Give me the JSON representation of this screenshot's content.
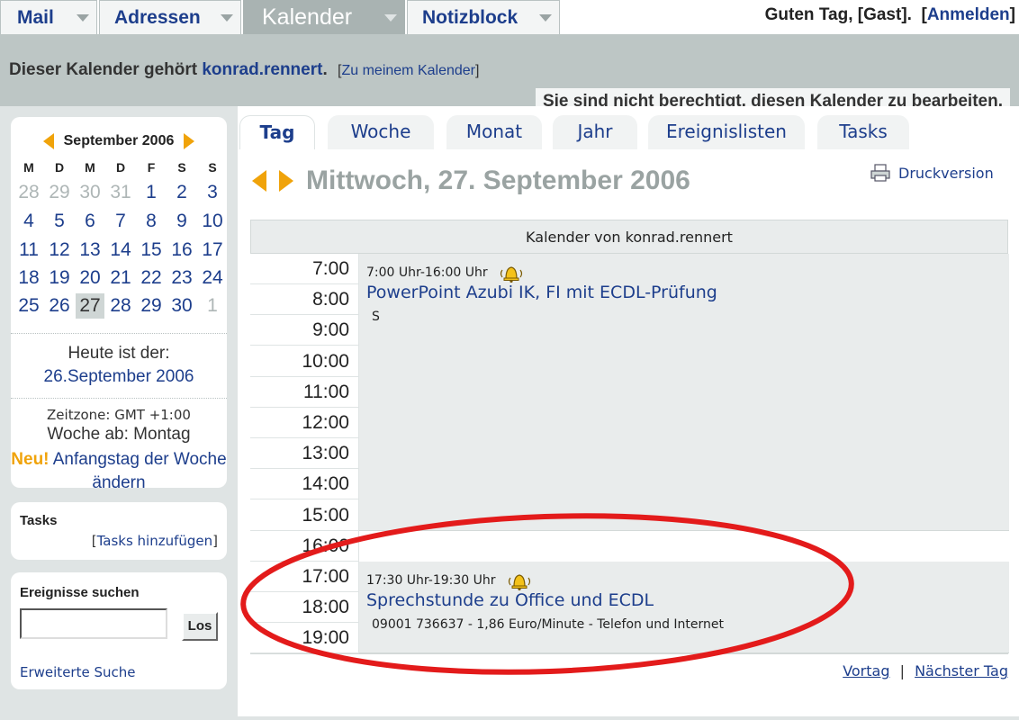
{
  "nav": {
    "tabs": [
      {
        "label": "Mail"
      },
      {
        "label": "Adressen"
      },
      {
        "label": "Kalender"
      },
      {
        "label": "Notizblock"
      }
    ],
    "greeting": "Guten Tag, [Gast].",
    "login_label": "Anmelden"
  },
  "owner": {
    "prefix": "Dieser Kalender gehört",
    "name": "konrad.rennert",
    "suffix": ".",
    "my_calendar_link": "Zu meinem Kalender"
  },
  "permission_notice": "Sie sind nicht berechtigt, diesen Kalender zu bearbeiten.",
  "mini_calendar": {
    "month_label": "September 2006",
    "weekdays": [
      "M",
      "D",
      "M",
      "D",
      "F",
      "S",
      "S"
    ],
    "weeks": [
      [
        "28",
        "29",
        "30",
        "31",
        "1",
        "2",
        "3"
      ],
      [
        "4",
        "5",
        "6",
        "7",
        "8",
        "9",
        "10"
      ],
      [
        "11",
        "12",
        "13",
        "14",
        "15",
        "16",
        "17"
      ],
      [
        "18",
        "19",
        "20",
        "21",
        "22",
        "23",
        "24"
      ],
      [
        "25",
        "26",
        "27",
        "28",
        "29",
        "30",
        "1"
      ]
    ],
    "today_label": "Heute ist der:",
    "today_value": "26.September 2006",
    "timezone": "Zeitzone: GMT +1:00",
    "week_start": "Woche ab: Montag",
    "new_badge": "Neu!",
    "change_week_start": "Anfangstag der Woche ändern"
  },
  "tasks_box": {
    "title": "Tasks",
    "add_link": "Tasks hinzufügen"
  },
  "search_box": {
    "title": "Ereignisse suchen",
    "input_value": "",
    "button_label": "Los",
    "advanced_link": "Erweiterte Suche"
  },
  "view_tabs": [
    {
      "label": "Tag",
      "active": true
    },
    {
      "label": "Woche",
      "active": false
    },
    {
      "label": "Monat",
      "active": false
    },
    {
      "label": "Jahr",
      "active": false
    },
    {
      "label": "Ereignislisten",
      "active": false
    },
    {
      "label": "Tasks",
      "active": false
    }
  ],
  "day_view": {
    "date_title": "Mittwoch, 27. September 2006",
    "print_label": "Druckversion",
    "calendar_header": "Kalender von konrad.rennert",
    "hours": [
      "7:00",
      "8:00",
      "9:00",
      "10:00",
      "11:00",
      "12:00",
      "13:00",
      "14:00",
      "15:00",
      "16:00",
      "17:00",
      "18:00",
      "19:00"
    ],
    "events": [
      {
        "time": "7:00 Uhr-16:00 Uhr",
        "title": "PowerPoint Azubi IK, FI mit ECDL-Prüfung",
        "description": "S"
      },
      {
        "time": "17:30 Uhr-19:30 Uhr",
        "title": "Sprechstunde zu Office und ECDL",
        "description": "09001 736637 - 1,86 Euro/Minute - Telefon und Internet"
      }
    ],
    "prev_day": "Vortag",
    "separator": "|",
    "next_day": "Nächster Tag"
  },
  "colors": {
    "link": "#1d3e8c",
    "accent_orange": "#f0a30a",
    "annotation_red": "#e31b1b",
    "band": "#bdc6c5"
  }
}
